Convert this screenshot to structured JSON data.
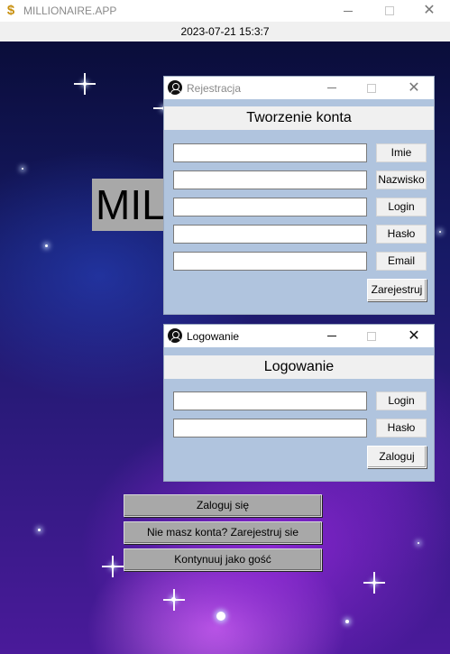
{
  "app": {
    "title": "MILLIONAIRE.APP",
    "datetime": "2023-07-21 15:3:7",
    "banner_text": "MILLIONAIRE"
  },
  "register_window": {
    "caption": "Rejestracja",
    "heading": "Tworzenie konta",
    "fields": [
      {
        "label": "Imie",
        "value": ""
      },
      {
        "label": "Nazwisko",
        "value": ""
      },
      {
        "label": "Login",
        "value": ""
      },
      {
        "label": "Hasło",
        "value": ""
      },
      {
        "label": "Email",
        "value": ""
      }
    ],
    "submit_label": "Zarejestruj"
  },
  "login_window": {
    "caption": "Logowanie",
    "heading": "Logowanie",
    "fields": [
      {
        "label": "Login",
        "value": ""
      },
      {
        "label": "Hasło",
        "value": ""
      }
    ],
    "submit_label": "Zaloguj"
  },
  "main_buttons": {
    "login": "Zaloguj się",
    "register": "Nie masz konta? Zarejestruj sie",
    "guest": "Kontynuuj jako gość"
  },
  "colors": {
    "window_bg": "#b0c4de",
    "heading_bg": "#f0f0f0",
    "main_button_bg": "#a8a8a8"
  }
}
